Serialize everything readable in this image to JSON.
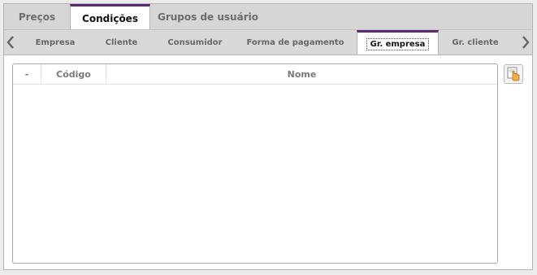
{
  "top_tabs": [
    {
      "label": "Preços",
      "active": false
    },
    {
      "label": "Condições",
      "active": true
    },
    {
      "label": "Grupos de usuário",
      "active": false
    }
  ],
  "sub_tabs": [
    {
      "label": "Empresa",
      "active": false
    },
    {
      "label": "Cliente",
      "active": false
    },
    {
      "label": "Consumidor",
      "active": false
    },
    {
      "label": "Forma de pagamento",
      "active": false
    },
    {
      "label": "Gr. empresa",
      "active": true
    },
    {
      "label": "Gr. cliente",
      "active": false
    }
  ],
  "grid": {
    "columns": [
      "-",
      "Código",
      "Nome"
    ],
    "rows": []
  },
  "icons": {
    "prev": "chevron-left-icon",
    "next": "chevron-right-icon",
    "side_button": "hand-pointer-document-icon"
  },
  "colors": {
    "accent": "#5b2a6e"
  }
}
